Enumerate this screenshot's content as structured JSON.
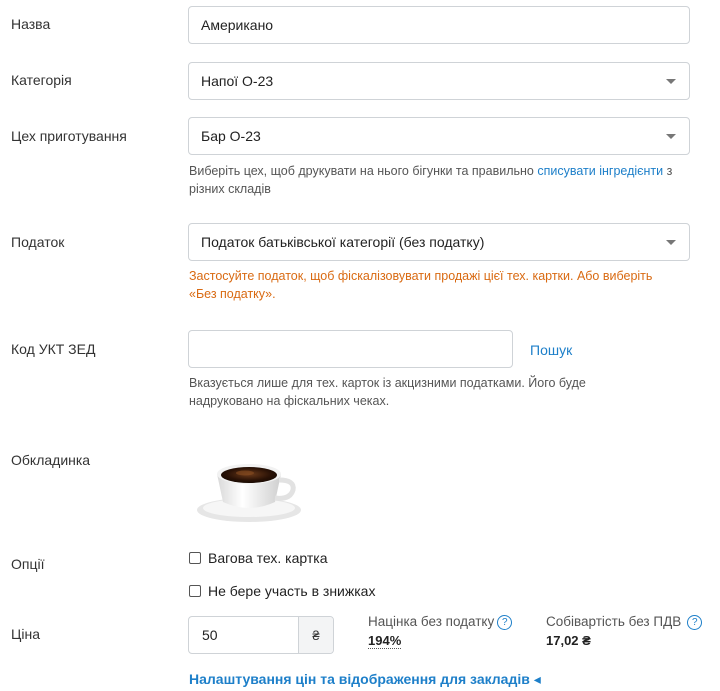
{
  "name": {
    "label": "Назва",
    "value": "Американо"
  },
  "category": {
    "label": "Категорія",
    "value": "Напої О-23"
  },
  "workshop": {
    "label": "Цех приготування",
    "value": "Бар О-23",
    "hint_pre": "Виберіть цех, щоб друкувати на нього бігунки та правильно ",
    "hint_link": "списувати інгредієнти",
    "hint_post": " з різних складів"
  },
  "tax": {
    "label": "Податок",
    "value": "Податок батьківської категорії (без податку)",
    "warning": "Застосуйте податок, щоб фіскалізовувати продажі цієї тех. картки. Або виберіть «Без податку»."
  },
  "ukt": {
    "label": "Код УКТ ЗЕД",
    "value": "",
    "search_label": "Пошук",
    "hint": "Вказується лише для тех. карток із акцизними податками. Його буде надруковано на фіскальних чеках."
  },
  "cover": {
    "label": "Обкладинка"
  },
  "options": {
    "label": "Опції",
    "weighted": "Вагова тех. картка",
    "no_discounts": "Не бере участь в знижках"
  },
  "price": {
    "label": "Ціна",
    "value": "50",
    "currency": "₴",
    "markup_label": "Націнка без податку",
    "markup_value": "194%",
    "cost_label": "Собівартість без ПДВ",
    "cost_value": "17,02 ₴",
    "help": "?"
  },
  "settings_link": "Налаштування цін та відображення для закладів ◂"
}
